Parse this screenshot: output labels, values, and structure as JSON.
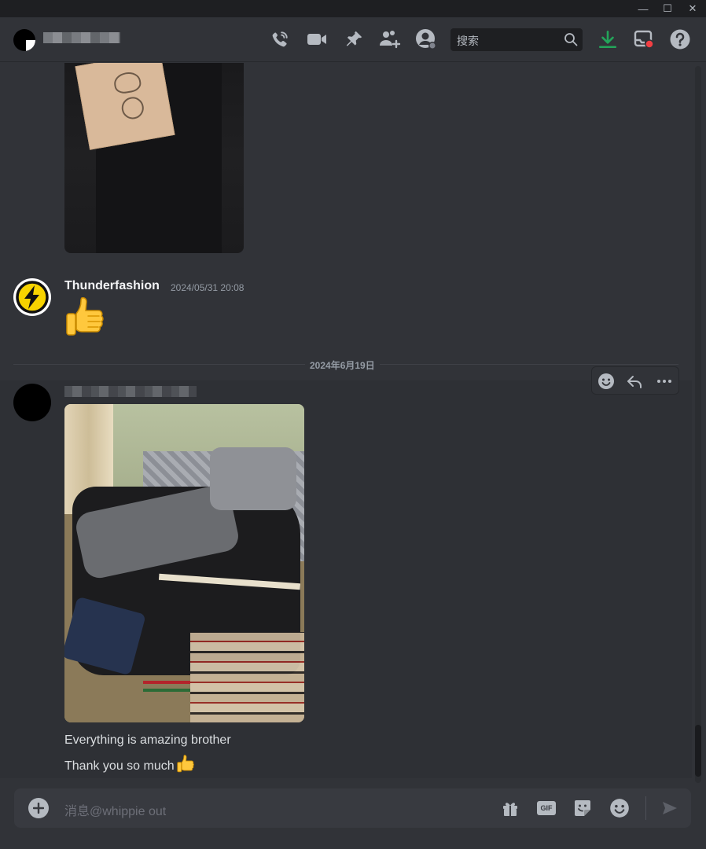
{
  "window": {
    "minimize_glyph": "—",
    "maximize_glyph": "☐",
    "close_glyph": "✕"
  },
  "header": {
    "icons": [
      "phone-call-icon",
      "video-call-icon",
      "pin-icon",
      "add-friend-icon",
      "profile-icon",
      "download-icon",
      "inbox-icon",
      "help-icon"
    ],
    "search_placeholder": "搜索",
    "accent_download": "#23a55a",
    "accent_notification": "#f23f43"
  },
  "messages": [
    {
      "author": "Thunderfashion",
      "timestamp": "2024/05/31 20:08",
      "content": "👍"
    }
  ],
  "date_divider": "2024年6月19日",
  "last_message": {
    "lines": [
      "Everything is amazing brother",
      "Thank you so much"
    ],
    "line2_emoji": "👍"
  },
  "composer": {
    "placeholder": "消息@whippie out",
    "gif_label": "GIF"
  },
  "colors": {
    "background": "#313338",
    "title_bar": "#1e1f22",
    "text": "#dbdee1",
    "muted": "#949ba4"
  }
}
